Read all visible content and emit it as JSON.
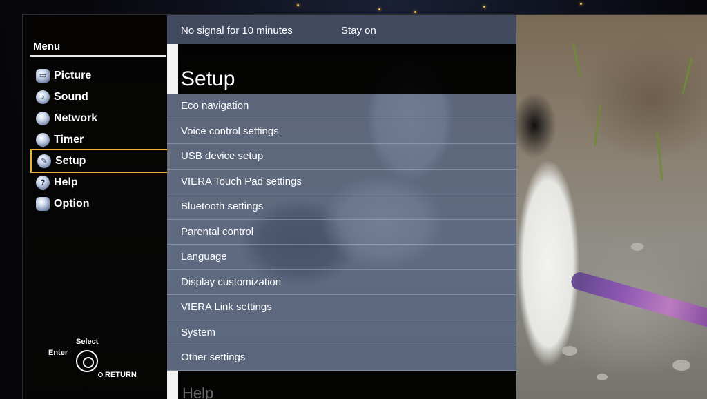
{
  "menu": {
    "title": "Menu",
    "items": [
      {
        "label": "Picture",
        "icon": "picture-icon",
        "glyph": "▭",
        "selected": false
      },
      {
        "label": "Sound",
        "icon": "sound-icon",
        "glyph": "♪",
        "selected": false
      },
      {
        "label": "Network",
        "icon": "network-icon",
        "glyph": "",
        "selected": false
      },
      {
        "label": "Timer",
        "icon": "timer-icon",
        "glyph": "",
        "selected": false
      },
      {
        "label": "Setup",
        "icon": "wrench-icon",
        "glyph": "✎",
        "selected": true
      },
      {
        "label": "Help",
        "icon": "help-icon",
        "glyph": "?",
        "selected": false
      },
      {
        "label": "Option",
        "icon": "option-icon",
        "glyph": "",
        "selected": false
      }
    ]
  },
  "status": {
    "text": "No signal for 10 minutes",
    "value": "Stay on"
  },
  "setup": {
    "title": "Setup",
    "options": [
      "Eco navigation",
      "Voice control settings",
      "USB device setup",
      "VIERA Touch Pad settings",
      "Bluetooth settings",
      "Parental control",
      "Language",
      "Display customization",
      "VIERA Link settings",
      "System",
      "Other settings"
    ],
    "help_label": "Help"
  },
  "nav_hint": {
    "select": "Select",
    "enter": "Enter",
    "return": "RETURN"
  },
  "colors": {
    "selection_border": "#e8b33b",
    "option_bg": "#526280",
    "status_bg": "#3c485f"
  }
}
